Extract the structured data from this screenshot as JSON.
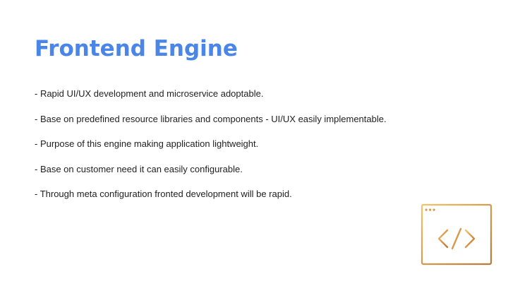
{
  "slide": {
    "title": "Frontend Engine",
    "bullets": [
      "- Rapid UI/UX development and microservice adoptable.",
      "- Base on predefined resource libraries and components - UI/UX easily implementable.",
      "- Purpose of this engine making application lightweight.",
      "- Base on customer need it can easily configurable.",
      "- Through meta configuration fronted development will be rapid."
    ]
  },
  "icon": {
    "name": "code-window-icon",
    "gradient": [
      "#f6c26a",
      "#d79a4b",
      "#b9783a"
    ]
  },
  "colors": {
    "title": "#4a86e8",
    "text": "#1f1f1f",
    "background": "#ffffff"
  }
}
